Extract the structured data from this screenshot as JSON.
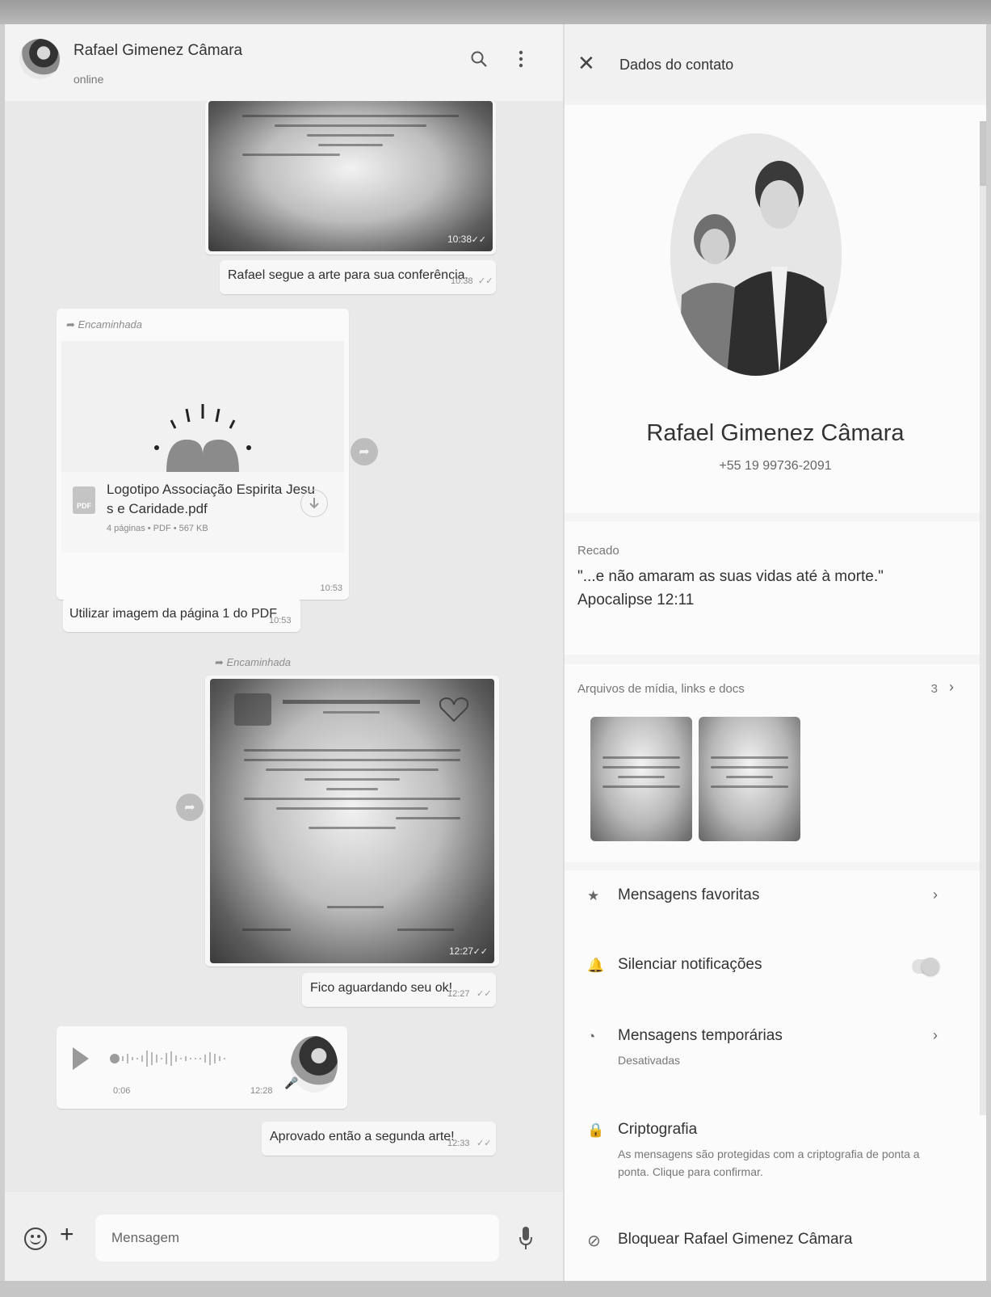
{
  "chat": {
    "contact_name": "Rafael Gimenez Câmara",
    "status": "online",
    "messages": [
      {
        "type": "image",
        "time": "10:38"
      },
      {
        "type": "text",
        "text": "Rafael segue a arte para sua conferência.",
        "time": "10:38"
      },
      {
        "type": "document",
        "forwarded_label": "Encaminhada",
        "file_name_line1": "Logotipo Associação Espirita Jesu",
        "file_name_line2": "s e Caridade.pdf",
        "meta": "4 páginas • PDF • 567 KB",
        "file_icon": "PDF",
        "time": "10:53"
      },
      {
        "type": "text",
        "text": "Utilizar imagem da página  1 do PDF",
        "time": "10:53"
      },
      {
        "type": "image",
        "forwarded_label": "Encaminhada",
        "time": "12:27"
      },
      {
        "type": "text",
        "text": "Fico aguardando seu ok!",
        "time": "12:27"
      },
      {
        "type": "audio",
        "duration": "0:06",
        "time": "12:28"
      },
      {
        "type": "text",
        "text": "Aprovado então a segunda arte!",
        "time": "12:33"
      }
    ],
    "input_placeholder": "Mensagem"
  },
  "info": {
    "title": "Dados do contato",
    "name": "Rafael Gimenez Câmara",
    "phone": "+55 19 99736-2091",
    "about_label": "Recado",
    "about_text": "\"...e não amaram as suas vidas até à morte.\" Apocalipse 12:11",
    "media_label": "Arquivos de mídia, links e docs",
    "media_count": "3",
    "rows": [
      {
        "label": "Mensagens favoritas",
        "icon": "star-icon"
      },
      {
        "label": "Silenciar notificações",
        "icon": "bell-icon",
        "toggle": false
      },
      {
        "label": "Mensagens temporárias",
        "sub": "Desativadas",
        "icon": "timer-icon"
      },
      {
        "label": "Criptografia",
        "sub": "As mensagens são protegidas com a criptografia de ponta a ponta. Clique para confirmar.",
        "icon": "lock-icon"
      },
      {
        "label": "Bloquear Rafael Gimenez Câmara",
        "icon": "block-icon"
      }
    ]
  }
}
